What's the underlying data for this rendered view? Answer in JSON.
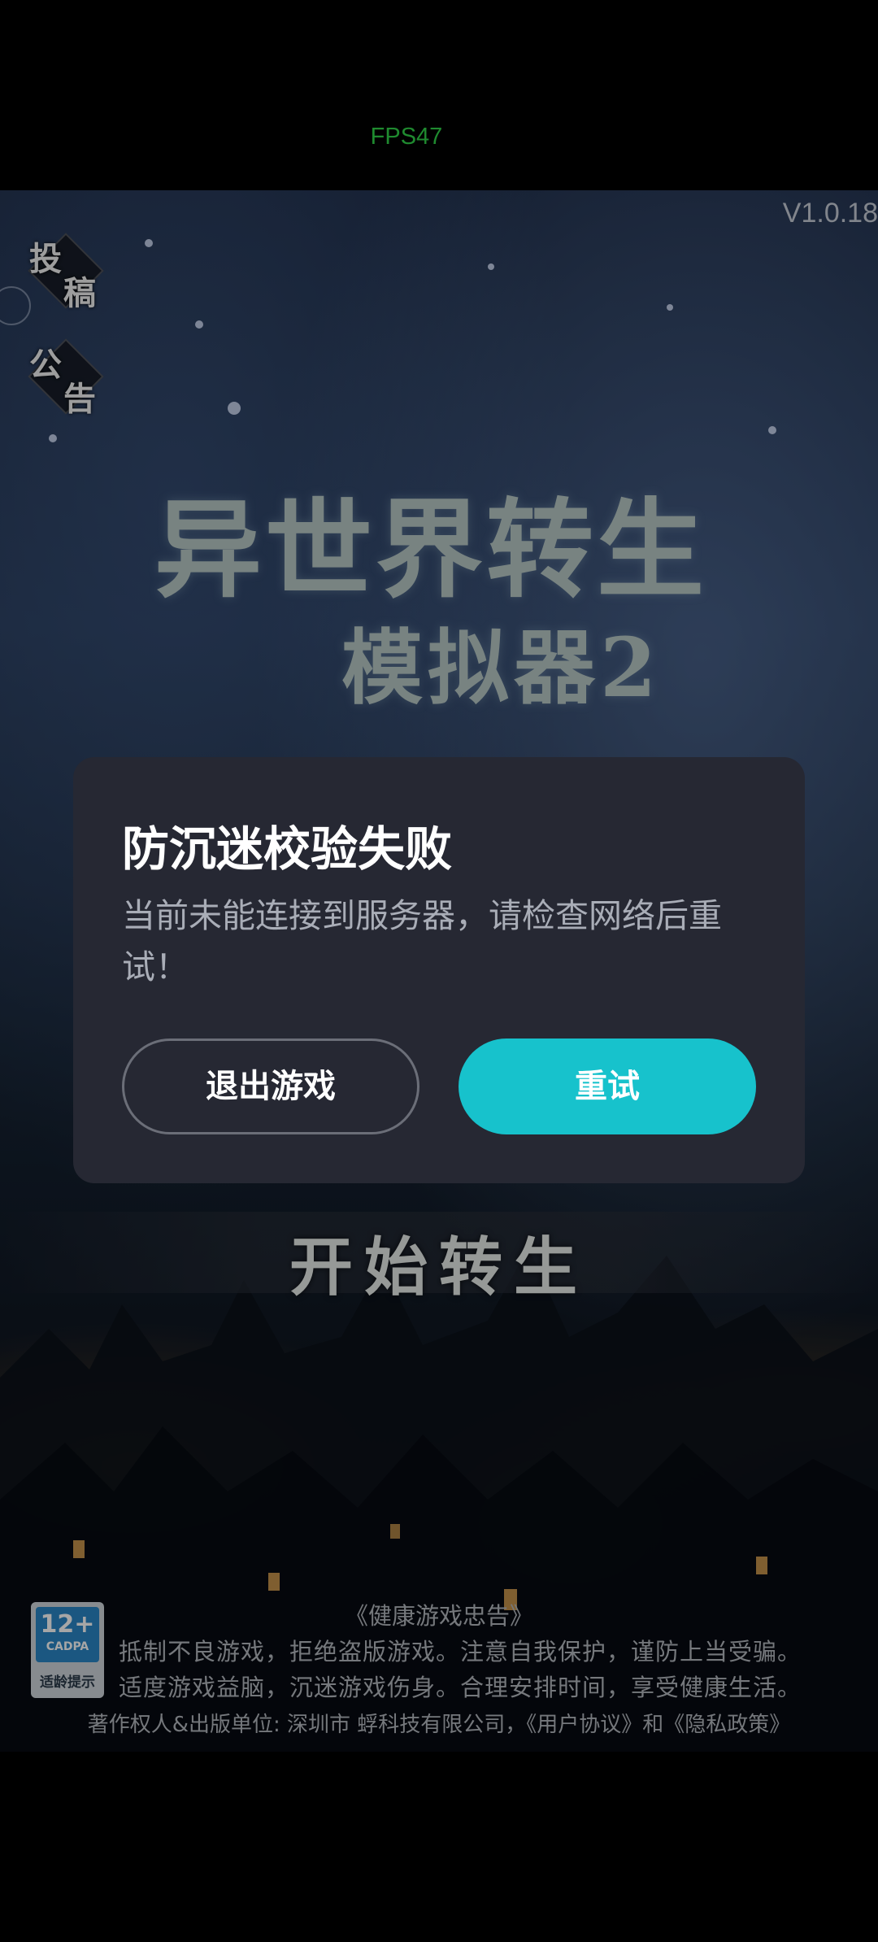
{
  "status": {
    "fps_label": "FPS47"
  },
  "game": {
    "version": "V1.0.18",
    "side_buttons": [
      {
        "char1": "投",
        "char2": "稿"
      },
      {
        "char1": "公",
        "char2": "告"
      }
    ],
    "logo": {
      "line1": "异世界转生",
      "line2": "模拟器2"
    },
    "start_button_label": "开始转生"
  },
  "dialog": {
    "title": "防沉迷校验失败",
    "message": "当前未能连接到服务器，请检查网络后重试！",
    "exit_label": "退出游戏",
    "retry_label": "重试"
  },
  "footer": {
    "notice_title": "《健康游戏忠告》",
    "notice_lines": [
      "抵制不良游戏，拒绝盗版游戏。注意自我保护，谨防上当受骗。",
      "适度游戏益脑，沉迷游戏伤身。合理安排时间，享受健康生活。"
    ],
    "copyright": "著作权人&出版单位: 深圳市 蜉科技有限公司，《用户协议》和《隐私政策》",
    "age_rating": {
      "age": "12+",
      "org": "CADPA",
      "tip": "适龄提示"
    }
  },
  "colors": {
    "dialog_bg": "#262833",
    "retry_button": "#17c2cc",
    "fps_text": "#1f8a2f"
  }
}
